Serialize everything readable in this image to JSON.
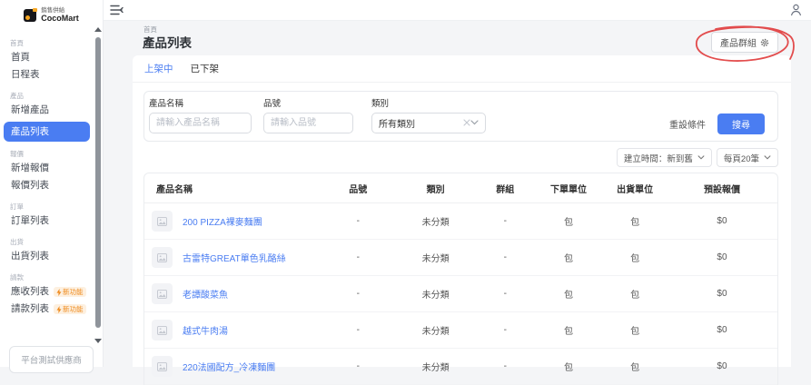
{
  "topbar": {
    "brand": "CocoMart",
    "brand_sub": "銷售供給"
  },
  "sidebar": {
    "sections": [
      {
        "label": "首頁",
        "items": [
          {
            "label": "首頁"
          },
          {
            "label": "日程表"
          }
        ]
      },
      {
        "label": "產品",
        "items": [
          {
            "label": "新增產品"
          },
          {
            "label": "產品列表",
            "active": true
          }
        ]
      },
      {
        "label": "報價",
        "items": [
          {
            "label": "新增報價"
          },
          {
            "label": "報價列表"
          }
        ]
      },
      {
        "label": "訂單",
        "items": [
          {
            "label": "訂單列表"
          }
        ]
      },
      {
        "label": "出貨",
        "items": [
          {
            "label": "出貨列表"
          }
        ]
      },
      {
        "label": "請款",
        "items": [
          {
            "label": "應收列表",
            "badge": "新功能"
          },
          {
            "label": "請款列表",
            "badge": "新功能"
          }
        ]
      }
    ],
    "footer": "平台測試供應商"
  },
  "header": {
    "breadcrumb": "首頁",
    "title": "產品列表",
    "group_button": "產品群組"
  },
  "tabs": [
    {
      "label": "上架中",
      "active": true
    },
    {
      "label": "已下架"
    }
  ],
  "filters": {
    "fields": [
      {
        "label": "產品名稱",
        "placeholder": "請輸入產品名稱"
      },
      {
        "label": "品號",
        "placeholder": "請輸入品號"
      },
      {
        "label": "類別",
        "value": "所有類別",
        "type": "select"
      }
    ],
    "reset": "重設條件",
    "search": "搜尋"
  },
  "sort": {
    "order": "建立時間：新到舊",
    "page_size": "每頁20筆"
  },
  "table": {
    "columns": [
      "產品名稱",
      "品號",
      "類別",
      "群組",
      "下單單位",
      "出貨單位",
      "預設報價"
    ],
    "rows": [
      {
        "name": "200 PIZZA裸麥麵團",
        "sku": "-",
        "category": "未分類",
        "group": "-",
        "order_unit": "包",
        "ship_unit": "包",
        "price": "$0"
      },
      {
        "name": "古雷特GREAT單色乳酪絲",
        "sku": "-",
        "category": "未分類",
        "group": "-",
        "order_unit": "包",
        "ship_unit": "包",
        "price": "$0"
      },
      {
        "name": "老譚酸菜魚",
        "sku": "-",
        "category": "未分類",
        "group": "-",
        "order_unit": "包",
        "ship_unit": "包",
        "price": "$0"
      },
      {
        "name": "越式牛肉湯",
        "sku": "-",
        "category": "未分類",
        "group": "-",
        "order_unit": "包",
        "ship_unit": "包",
        "price": "$0"
      },
      {
        "name": "220法國配方_冷凍麵團",
        "sku": "-",
        "category": "未分類",
        "group": "-",
        "order_unit": "包",
        "ship_unit": "包",
        "price": "$0"
      }
    ]
  },
  "colors": {
    "accent_blue": "#4a7df2",
    "badge_orange": "#ef8b1e",
    "annotation_red": "#e03a3a",
    "page_bg": "#f4f5f7"
  },
  "icons": {
    "gear": "settings-gear",
    "bolt": "new-feature-lightning",
    "user": "account-person",
    "collapse": "menu-fold",
    "clear": "clear-x",
    "chevron": "chevron-down",
    "image_placeholder": "product-image-placeholder"
  }
}
